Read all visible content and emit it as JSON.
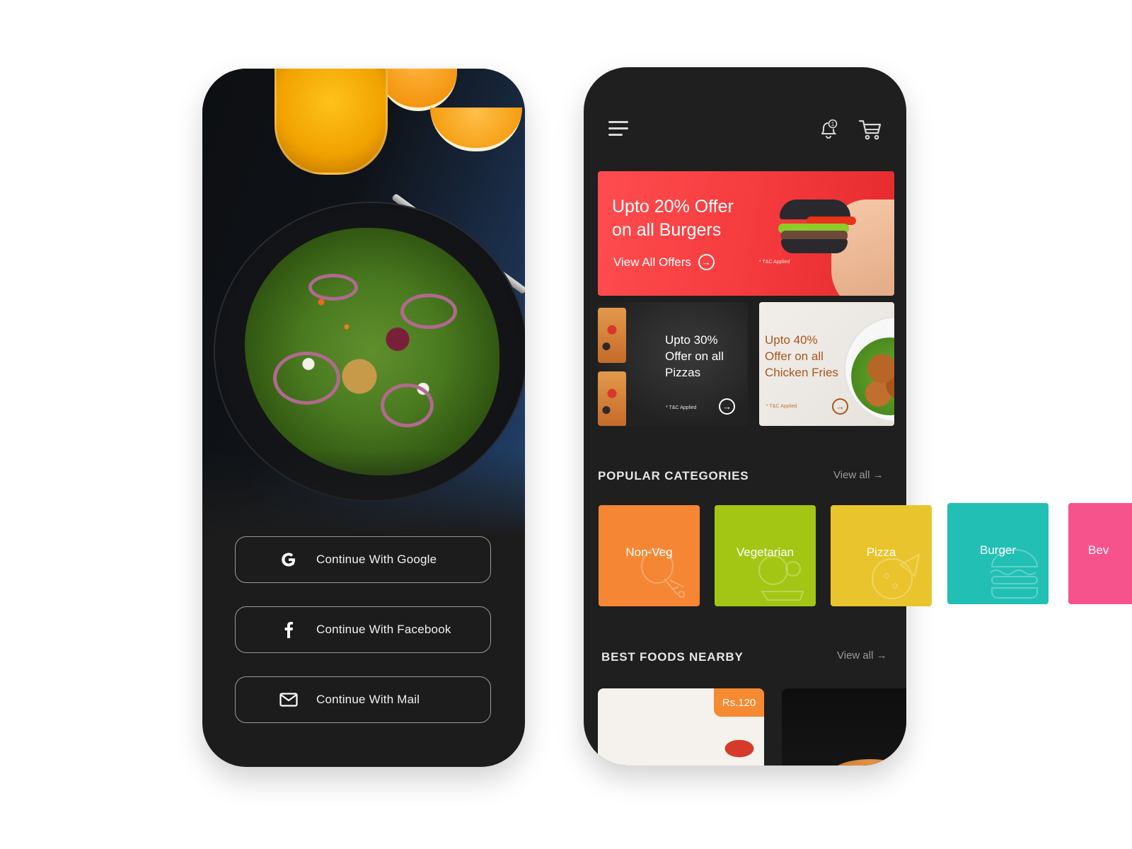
{
  "login_screen": {
    "buttons": [
      {
        "icon": "google-icon",
        "label": "Continue With Google"
      },
      {
        "icon": "facebook-icon",
        "label": "Continue With Facebook"
      },
      {
        "icon": "mail-icon",
        "label": "Continue With Mail"
      }
    ]
  },
  "home_screen": {
    "header": {
      "menu_icon": "hamburger-menu-icon",
      "notification_icon": "bell-icon",
      "notification_count": "1",
      "cart_icon": "shopping-cart-icon"
    },
    "main_offer": {
      "title": "Upto 20% Offer on all Burgers",
      "title_line1": "Upto 20% Offer",
      "title_line2": "on all Burgers",
      "cta": "View All Offers",
      "terms": "* T&C Applied",
      "background_color": "#F44145"
    },
    "secondary_offers": [
      {
        "title_lines": [
          "Upto 30%",
          "Offer on all",
          "Pizzas"
        ],
        "terms": "* T&C Applied",
        "text_color": "#FFFFFF"
      },
      {
        "title_lines": [
          "Upto 40%",
          "Offer on all",
          "Chicken Fries"
        ],
        "terms": "* T&C Applied",
        "text_color": "#A8561E"
      }
    ],
    "popular_categories": {
      "title": "POPULAR CATEGORIES",
      "view_all": "View all →",
      "items": [
        {
          "label": "Non-Veg",
          "color": "#F58634",
          "icon": "chicken-leg-icon"
        },
        {
          "label": "Vegetarian",
          "color": "#A3C614",
          "icon": "vegetables-icon"
        },
        {
          "label": "Pizza",
          "color": "#EAC42C",
          "icon": "pizza-icon"
        },
        {
          "label": "Burger",
          "color": "#22BFB4",
          "icon": "burger-icon"
        },
        {
          "label": "Bev",
          "color": "#F6538D",
          "icon": "beverage-icon"
        }
      ]
    },
    "best_foods": {
      "title": "BEST FOODS NEARBY",
      "view_all": "View all →",
      "items": [
        {
          "price": "Rs.120"
        }
      ]
    }
  }
}
